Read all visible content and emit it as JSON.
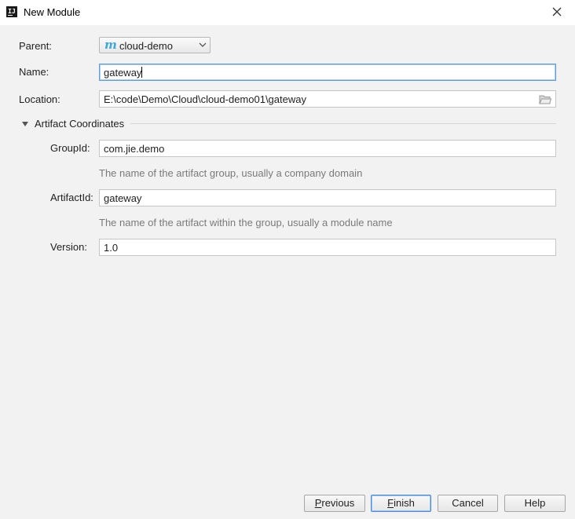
{
  "window": {
    "title": "New Module",
    "app_icon_text": "IJ"
  },
  "form": {
    "parent": {
      "label": "Parent:",
      "value": "cloud-demo",
      "icon": "maven-m-icon"
    },
    "name": {
      "label": "Name:",
      "value": "gateway"
    },
    "location": {
      "label": "Location:",
      "value": "E:\\code\\Demo\\Cloud\\cloud-demo01\\gateway"
    }
  },
  "artifact": {
    "section_label": "Artifact Coordinates",
    "group_id": {
      "label": "GroupId:",
      "value": "com.jie.demo",
      "hint": "The name of the artifact group, usually a company domain"
    },
    "artifact_id": {
      "label": "ArtifactId:",
      "value": "gateway",
      "hint": "The name of the artifact within the group, usually a module name"
    },
    "version": {
      "label": "Version:",
      "value": "1.0"
    }
  },
  "buttons": {
    "previous": {
      "mnemonic": "P",
      "rest": "revious"
    },
    "finish": {
      "mnemonic": "F",
      "rest": "inish"
    },
    "cancel": "Cancel",
    "help": "Help"
  },
  "colors": {
    "accent": "#5f9dd6",
    "maven_icon": "#3ea8d8",
    "background": "#f2f2f2"
  }
}
